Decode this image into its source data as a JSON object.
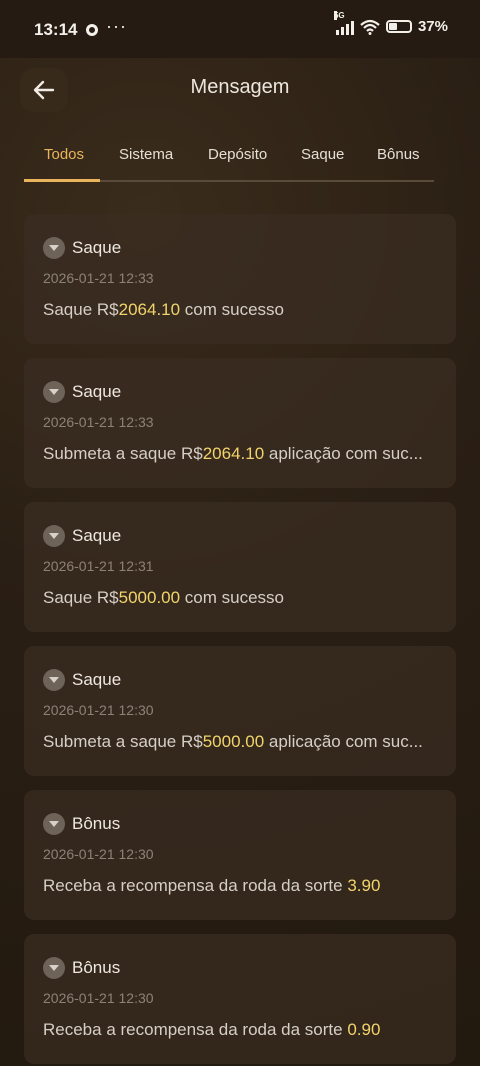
{
  "status_bar": {
    "time": "13:14",
    "dots": "···",
    "network": "5G",
    "battery_percent": "37%",
    "battery_level": 0.37
  },
  "header": {
    "title": "Mensagem"
  },
  "tabs": [
    {
      "label": "Todos",
      "active": true
    },
    {
      "label": "Sistema",
      "active": false
    },
    {
      "label": "Depósito",
      "active": false
    },
    {
      "label": "Saque",
      "active": false
    },
    {
      "label": "Bônus",
      "active": false
    }
  ],
  "colors": {
    "accent": "#e9b45c",
    "amount": "#f1d46b"
  },
  "messages": [
    {
      "title": "Saque",
      "date": "2026-01-21 12:33",
      "prefix": "Saque R$",
      "amount": "2064.10",
      "suffix": " com sucesso"
    },
    {
      "title": "Saque",
      "date": "2026-01-21 12:33",
      "prefix": "Submeta a saque R$",
      "amount": "2064.10",
      "suffix": " aplicação com suc..."
    },
    {
      "title": "Saque",
      "date": "2026-01-21 12:31",
      "prefix": "Saque R$",
      "amount": "5000.00",
      "suffix": " com sucesso"
    },
    {
      "title": "Saque",
      "date": "2026-01-21 12:30",
      "prefix": "Submeta a saque R$",
      "amount": "5000.00",
      "suffix": " aplicação com suc..."
    },
    {
      "title": "Bônus",
      "date": "2026-01-21 12:30",
      "prefix": "Receba a recompensa da roda da sorte ",
      "amount": "3.90",
      "suffix": ""
    },
    {
      "title": "Bônus",
      "date": "2026-01-21 12:30",
      "prefix": "Receba a recompensa da roda da sorte ",
      "amount": "0.90",
      "suffix": ""
    }
  ]
}
